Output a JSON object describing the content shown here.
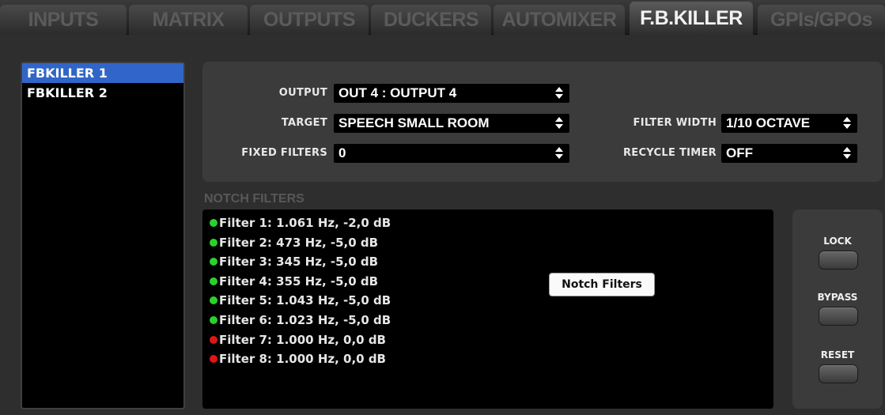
{
  "tabs": [
    {
      "label": "INPUTS"
    },
    {
      "label": "MATRIX"
    },
    {
      "label": "OUTPUTS"
    },
    {
      "label": "DUCKERS"
    },
    {
      "label": "AUTOMIXER"
    },
    {
      "label": "F.B.KILLER",
      "active": true
    },
    {
      "label": "GPIs/GPOs"
    }
  ],
  "fbkillers": [
    {
      "label": "FBKILLER 1",
      "selected": true
    },
    {
      "label": "FBKILLER 2"
    }
  ],
  "config": {
    "output_label": "OUTPUT",
    "output_value": "OUT 4 : OUTPUT 4",
    "target_label": "TARGET",
    "target_value": "SPEECH SMALL ROOM",
    "fixed_filters_label": "FIXED FILTERS",
    "fixed_filters_value": "0",
    "filter_width_label": "FILTER WIDTH",
    "filter_width_value": "1/10 OCTAVE",
    "recycle_timer_label": "RECYCLE TIMER",
    "recycle_timer_value": "OFF"
  },
  "notch_filters": {
    "title": "NOTCH FILTERS",
    "tooltip": "Notch Filters",
    "filters": [
      {
        "text": "Filter 1: 1.061 Hz, -2,0 dB",
        "status": "active"
      },
      {
        "text": "Filter 2: 473 Hz, -5,0 dB",
        "status": "active"
      },
      {
        "text": "Filter 3: 345 Hz, -5,0 dB",
        "status": "active"
      },
      {
        "text": "Filter 4: 355 Hz, -5,0 dB",
        "status": "active"
      },
      {
        "text": "Filter 5: 1.043 Hz, -5,0 dB",
        "status": "active"
      },
      {
        "text": "Filter 6: 1.023 Hz, -5,0 dB",
        "status": "active"
      },
      {
        "text": "Filter 7: 1.000 Hz, 0,0 dB",
        "status": "inactive"
      },
      {
        "text": "Filter 8: 1.000 Hz, 0,0 dB",
        "status": "inactive"
      }
    ]
  },
  "controls": {
    "lock_label": "LOCK",
    "bypass_label": "BYPASS",
    "reset_label": "RESET"
  },
  "colors": {
    "active_dot": "#2bd12b",
    "inactive_dot": "#e01515",
    "selection": "#3166c8"
  }
}
